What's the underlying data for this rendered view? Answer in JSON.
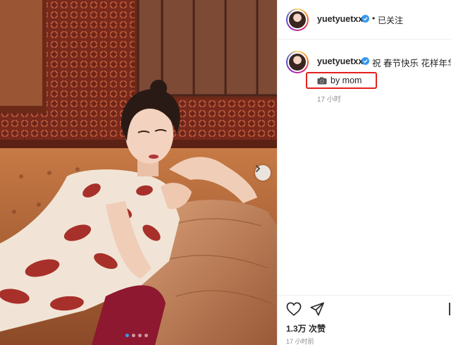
{
  "post": {
    "author": "yuetyuetxx",
    "separator": "•",
    "follow_status": "已关注",
    "caption_line1": "祝 春节快乐 花样年华",
    "caption_line2": "by mom",
    "caption_time": "17 小时",
    "likes": "1.3万 次赞",
    "post_time": "17 小时前"
  },
  "carousel": {
    "total": 4,
    "current": 1
  },
  "icons": {
    "verified": "verified-badge-icon",
    "camera": "camera-icon",
    "like": "heart-icon",
    "share": "paper-plane-icon",
    "save": "bookmark-icon",
    "next": "chevron-right-icon"
  },
  "colors": {
    "accent": "#3897f0",
    "highlight_box": "#e32020",
    "muted": "#8e8e8e"
  }
}
